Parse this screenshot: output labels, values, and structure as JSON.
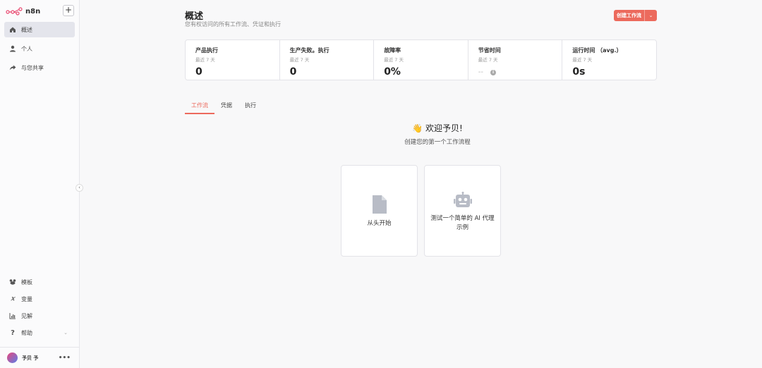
{
  "app": {
    "name": "n8n",
    "add_label": "+"
  },
  "sidebar": {
    "top_items": [
      {
        "label": "概述",
        "icon": "home-icon",
        "active": true
      },
      {
        "label": "个人",
        "icon": "user-icon",
        "active": false
      },
      {
        "label": "与您共享",
        "icon": "share-icon",
        "active": false
      }
    ],
    "bottom_items": [
      {
        "label": "模板",
        "icon": "templates-icon"
      },
      {
        "label": "变量",
        "icon": "variables-icon"
      },
      {
        "label": "见解",
        "icon": "insights-icon"
      },
      {
        "label": "帮助",
        "icon": "help-icon"
      }
    ],
    "user": {
      "name": "予贝 予",
      "more": "•••"
    },
    "collapse_glyph": "‹"
  },
  "header": {
    "title": "概述",
    "subtitle": "您有权访问的所有工作流、凭证和执行",
    "create_button": "创建工作流",
    "create_dropdown": "⌄"
  },
  "stats": [
    {
      "label": "产品执行",
      "period": "最近 7 天",
      "value": "0"
    },
    {
      "label": "生产失败。执行",
      "period": "最近 7 天",
      "value": "0"
    },
    {
      "label": "故障率",
      "period": "最近 7 天",
      "value": "0%"
    },
    {
      "label": "节省时间",
      "period": "最近 7 天",
      "value": "--"
    },
    {
      "label": "运行时间 （avg.）",
      "period": "最近 7 天",
      "value": "0s"
    }
  ],
  "tabs": [
    {
      "label": "工作流",
      "active": true
    },
    {
      "label": "凭据",
      "active": false
    },
    {
      "label": "执行",
      "active": false
    }
  ],
  "empty_state": {
    "welcome": "👋 欢迎予贝!",
    "subtitle": "创建您的第一个工作流程",
    "cards": [
      {
        "label": "从头开始",
        "icon": "file-icon"
      },
      {
        "label": "测试一个简单的 AI 代理示例",
        "icon": "robot-icon"
      }
    ]
  },
  "colors": {
    "accent": "#ec6a5d",
    "active_nav": "#e4e5ec"
  }
}
